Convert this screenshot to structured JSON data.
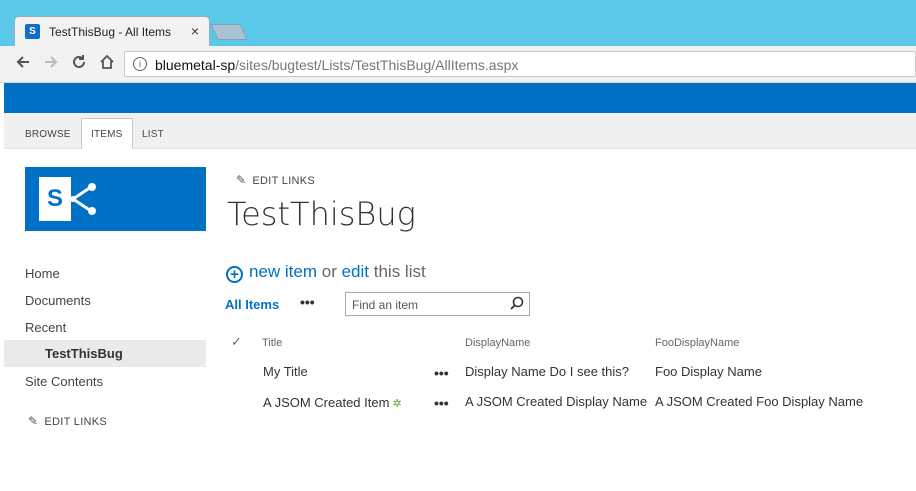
{
  "browser": {
    "tab_title": "TestThisBug - All Items",
    "tab_close": "×",
    "favicon": "S",
    "url_host": "bluemetal-sp",
    "url_path": "/sites/bugtest/Lists/TestThisBug/AllItems.aspx",
    "info_icon": "i"
  },
  "ribbon": {
    "tabs": [
      "BROWSE",
      "ITEMS",
      "LIST"
    ],
    "active_tab": "ITEMS"
  },
  "logo": {
    "letter": "S"
  },
  "top": {
    "edit_links": "EDIT LINKS"
  },
  "page": {
    "title": "TestThisBug"
  },
  "quicklaunch": {
    "items": [
      "Home",
      "Documents",
      "Recent",
      "TestThisBug",
      "Site Contents"
    ],
    "selected": "TestThisBug",
    "edit_links": "EDIT LINKS"
  },
  "actions": {
    "new_item": "new item",
    "or": " or ",
    "edit": "edit",
    "this_list": " this list"
  },
  "views": {
    "all_items": "All Items",
    "more": "•••",
    "search_placeholder": "Find an item"
  },
  "list": {
    "columns": [
      "Title",
      "DisplayName",
      "FooDisplayName"
    ],
    "rows": [
      {
        "title": "My Title",
        "display_name": "Display Name Do I see this?",
        "foo_display_name": "Foo Display Name",
        "is_new": false
      },
      {
        "title": "A JSOM Created Item",
        "display_name": "A JSOM Created Display Name",
        "foo_display_name": "A JSOM Created Foo Display Name",
        "is_new": true
      }
    ],
    "row_more": "•••",
    "new_glyph": "✲"
  },
  "colors": {
    "suite": "#0072c6",
    "tabstrip": "#5bc8ea"
  }
}
